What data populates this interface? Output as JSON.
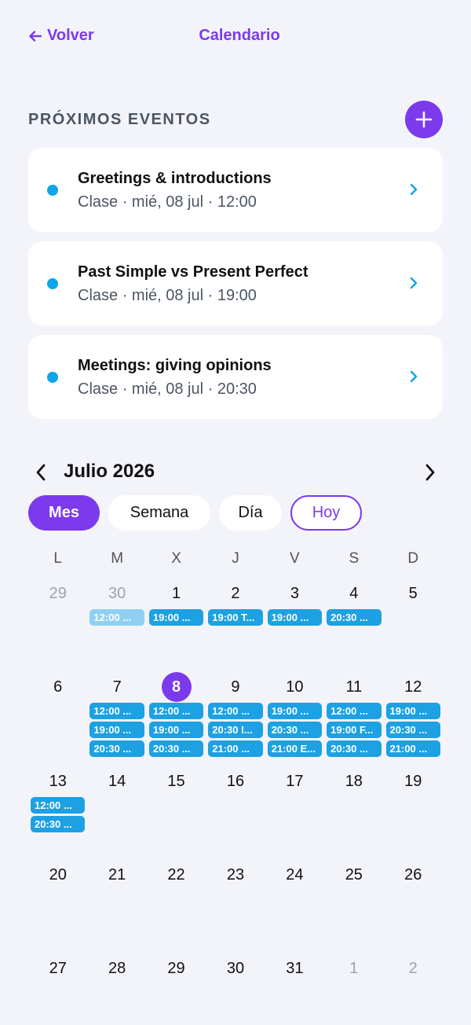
{
  "header": {
    "back_label": "Volver",
    "title": "Calendario"
  },
  "upcoming": {
    "section_title": "PRÓXIMOS EVENTOS",
    "events": [
      {
        "title": "Greetings & introductions",
        "subtitle": "Clase · mié, 08 jul · 12:00"
      },
      {
        "title": "Past Simple vs Present Perfect",
        "subtitle": "Clase · mié, 08 jul · 19:00"
      },
      {
        "title": "Meetings: giving opinions",
        "subtitle": "Clase · mié, 08 jul · 20:30"
      }
    ]
  },
  "calendar": {
    "month_label": "Julio 2026",
    "views": {
      "month": "Mes",
      "week": "Semana",
      "day": "Día",
      "today": "Hoy"
    },
    "weekdays": [
      "L",
      "M",
      "X",
      "J",
      "V",
      "S",
      "D"
    ],
    "weeks": [
      [
        {
          "day": "29",
          "other": true,
          "events": []
        },
        {
          "day": "30",
          "other": true,
          "events": [
            {
              "label": "12:00 ...",
              "faded": true
            }
          ]
        },
        {
          "day": "1",
          "events": [
            {
              "label": "19:00 ..."
            }
          ]
        },
        {
          "day": "2",
          "events": [
            {
              "label": "19:00 T..."
            }
          ]
        },
        {
          "day": "3",
          "events": [
            {
              "label": "19:00 ..."
            }
          ]
        },
        {
          "day": "4",
          "events": [
            {
              "label": "20:30 ..."
            }
          ]
        },
        {
          "day": "5",
          "events": []
        }
      ],
      [
        {
          "day": "6",
          "events": []
        },
        {
          "day": "7",
          "events": [
            {
              "label": "12:00 ..."
            },
            {
              "label": "19:00 ..."
            },
            {
              "label": "20:30 ..."
            }
          ]
        },
        {
          "day": "8",
          "today": true,
          "events": [
            {
              "label": "12:00 ..."
            },
            {
              "label": "19:00 ..."
            },
            {
              "label": "20:30 ..."
            }
          ]
        },
        {
          "day": "9",
          "events": [
            {
              "label": "12:00 ..."
            },
            {
              "label": "20:30 I..."
            },
            {
              "label": "21:00 ..."
            }
          ]
        },
        {
          "day": "10",
          "events": [
            {
              "label": "19:00 ..."
            },
            {
              "label": "20:30 ..."
            },
            {
              "label": "21:00 E..."
            }
          ]
        },
        {
          "day": "11",
          "events": [
            {
              "label": "12:00 ..."
            },
            {
              "label": "19:00 F..."
            },
            {
              "label": "20:30 ..."
            }
          ]
        },
        {
          "day": "12",
          "events": [
            {
              "label": "19:00 ..."
            },
            {
              "label": "20:30 ..."
            },
            {
              "label": "21:00 ..."
            }
          ]
        }
      ],
      [
        {
          "day": "13",
          "events": [
            {
              "label": "12:00 ..."
            },
            {
              "label": "20:30 ..."
            }
          ]
        },
        {
          "day": "14",
          "events": []
        },
        {
          "day": "15",
          "events": []
        },
        {
          "day": "16",
          "events": []
        },
        {
          "day": "17",
          "events": []
        },
        {
          "day": "18",
          "events": []
        },
        {
          "day": "19",
          "events": []
        }
      ],
      [
        {
          "day": "20",
          "events": []
        },
        {
          "day": "21",
          "events": []
        },
        {
          "day": "22",
          "events": []
        },
        {
          "day": "23",
          "events": []
        },
        {
          "day": "24",
          "events": []
        },
        {
          "day": "25",
          "events": []
        },
        {
          "day": "26",
          "events": []
        }
      ],
      [
        {
          "day": "27",
          "events": []
        },
        {
          "day": "28",
          "events": []
        },
        {
          "day": "29",
          "events": []
        },
        {
          "day": "30",
          "events": []
        },
        {
          "day": "31",
          "events": []
        },
        {
          "day": "1",
          "other": true,
          "events": []
        },
        {
          "day": "2",
          "other": true,
          "events": []
        }
      ]
    ]
  },
  "colors": {
    "accent": "#7c3aed",
    "event": "#1da1e2",
    "event_faded": "#8fd0f2"
  },
  "icons": {
    "back": "arrow-left-icon",
    "add": "plus-icon",
    "next": "chevron-right-icon",
    "prev": "chevron-left-icon"
  }
}
